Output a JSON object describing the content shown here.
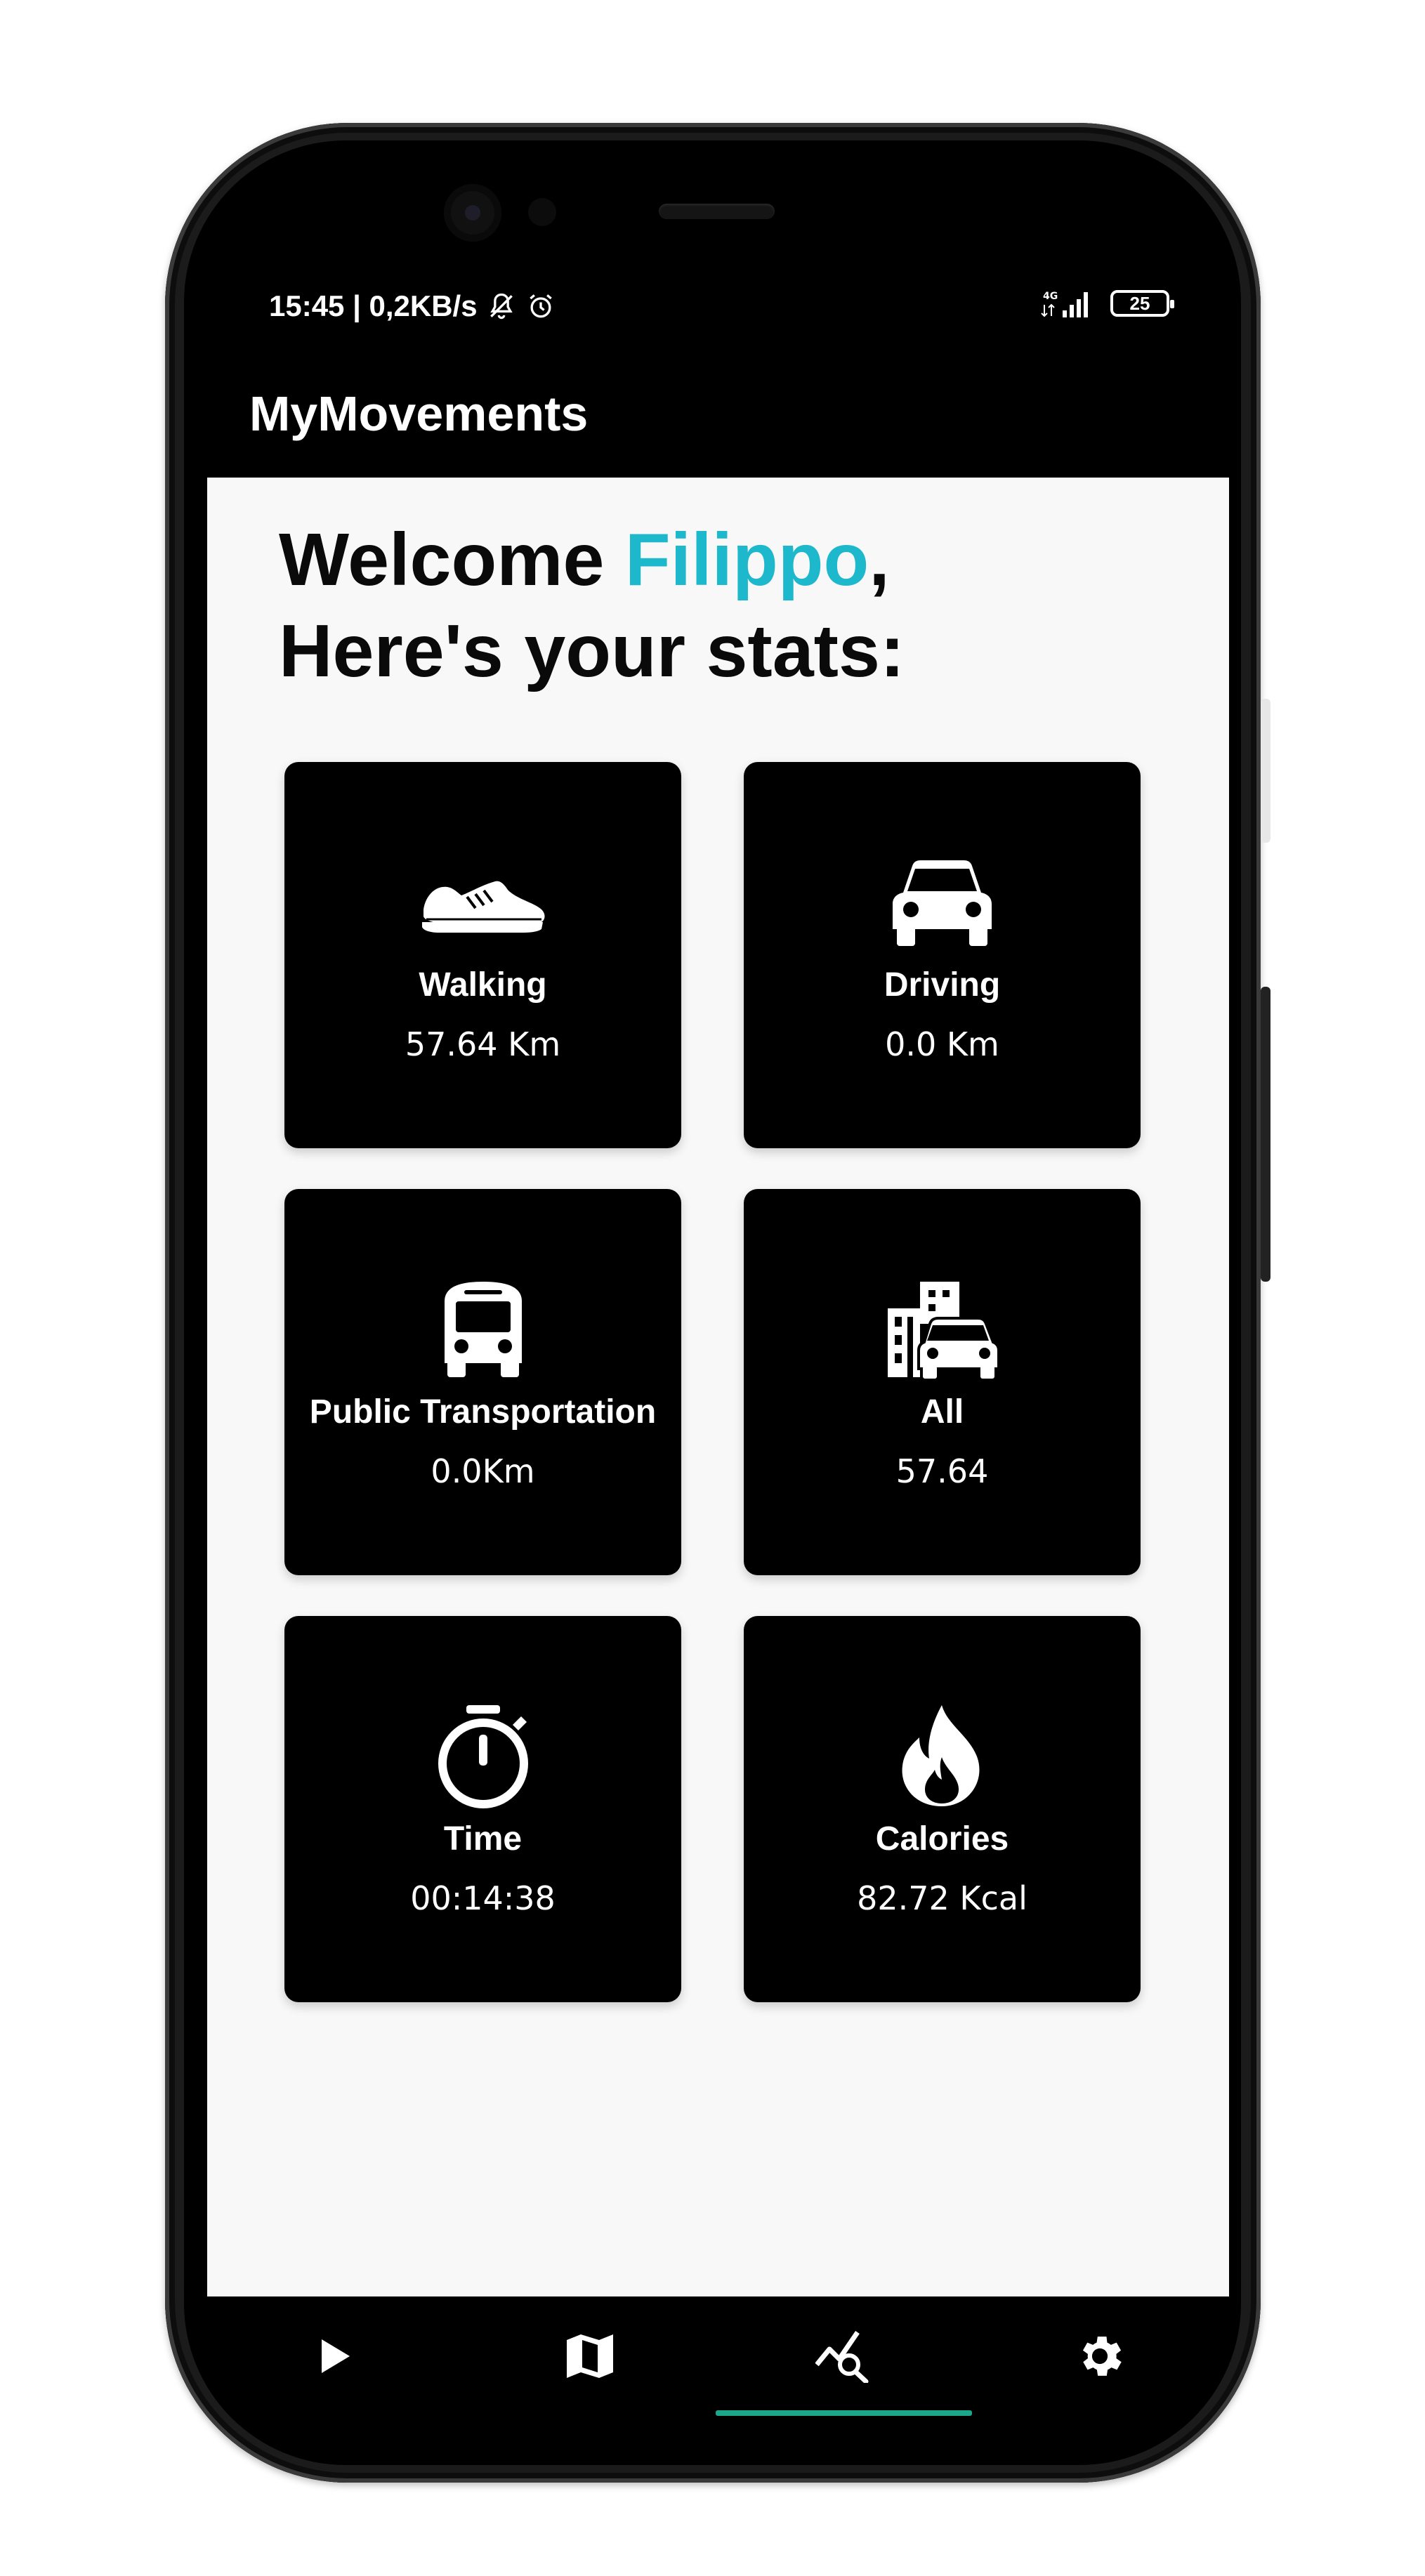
{
  "status_bar": {
    "time_network": "15:45 | 0,2KB/s",
    "network_type": "4G",
    "battery": "25"
  },
  "app": {
    "title": "MyMovements"
  },
  "welcome": {
    "greeting": "Welcome ",
    "user_name": "Filippo",
    "comma": ",",
    "subtitle": "Here's your stats:"
  },
  "colors": {
    "accent": "#1eb8cc",
    "card_background": "#000000",
    "nav_indicator": "#1aa78a"
  },
  "stats": [
    {
      "icon": "shoe-icon",
      "label": "Walking",
      "value": "57.64 Km"
    },
    {
      "icon": "car-icon",
      "label": "Driving",
      "value": "0.0 Km"
    },
    {
      "icon": "bus-icon",
      "label": "Public Transportation",
      "value": "0.0Km"
    },
    {
      "icon": "city-car-icon",
      "label": "All",
      "value": "57.64"
    },
    {
      "icon": "stopwatch-icon",
      "label": "Time",
      "value": "00:14:38"
    },
    {
      "icon": "fire-icon",
      "label": "Calories",
      "value": "82.72 Kcal"
    }
  ],
  "bottom_nav": [
    {
      "icon": "play-icon",
      "selected": false
    },
    {
      "icon": "map-icon",
      "selected": false
    },
    {
      "icon": "stats-search-icon",
      "selected": true
    },
    {
      "icon": "gear-icon",
      "selected": false
    }
  ]
}
